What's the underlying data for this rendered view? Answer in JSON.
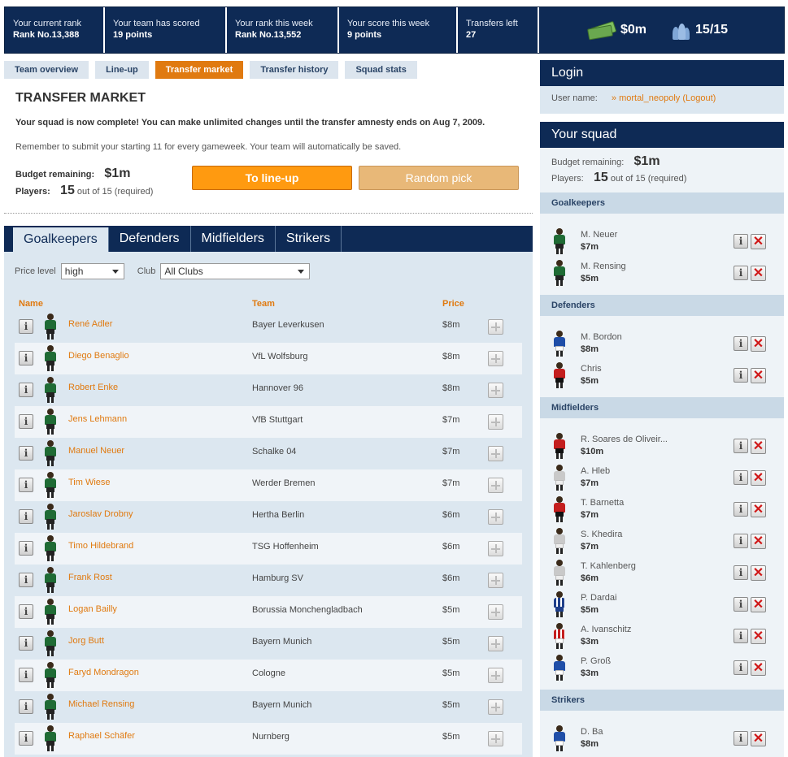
{
  "stats": [
    {
      "label": "Your current rank",
      "value": "Rank No.13,388"
    },
    {
      "label": "Your team has scored",
      "value": "19 points"
    },
    {
      "label": "Your rank this week",
      "value": "Rank No.13,552"
    },
    {
      "label": "Your score this week",
      "value": "9 points"
    },
    {
      "label": "Transfers left",
      "value": "27"
    }
  ],
  "summary": {
    "money": "$0m",
    "players": "15/15"
  },
  "nav_tabs": [
    "Team overview",
    "Line-up",
    "Transfer market",
    "Transfer history",
    "Squad stats"
  ],
  "market": {
    "title": "TRANSFER MARKET",
    "message": "Your squad is now complete! You can make unlimited changes until the transfer amnesty ends on Aug 7, 2009.",
    "reminder": "Remember to submit your starting 11 for every gameweek. Your team will automatically be saved.",
    "budget_label": "Budget remaining:",
    "budget_value": "$1m",
    "players_label": "Players:",
    "players_value": "15",
    "players_suffix": "out of 15 (required)",
    "lineup_button": "To line-up",
    "random_button": "Random pick"
  },
  "position_tabs": [
    "Goalkeepers",
    "Defenders",
    "Midfielders",
    "Strikers"
  ],
  "filters": {
    "price_label": "Price level",
    "price_value": "high",
    "club_label": "Club",
    "club_value": "All Clubs"
  },
  "columns": {
    "name": "Name",
    "team": "Team",
    "price": "Price"
  },
  "players": [
    {
      "name": "René Adler",
      "team": "Bayer Leverkusen",
      "price": "$8m"
    },
    {
      "name": "Diego Benaglio",
      "team": "VfL Wolfsburg",
      "price": "$8m"
    },
    {
      "name": "Robert Enke",
      "team": "Hannover 96",
      "price": "$8m"
    },
    {
      "name": "Jens Lehmann",
      "team": "VfB Stuttgart",
      "price": "$7m"
    },
    {
      "name": "Manuel Neuer",
      "team": "Schalke 04",
      "price": "$7m"
    },
    {
      "name": "Tim Wiese",
      "team": "Werder Bremen",
      "price": "$7m"
    },
    {
      "name": "Jaroslav Drobny",
      "team": "Hertha Berlin",
      "price": "$6m"
    },
    {
      "name": "Timo Hildebrand",
      "team": "TSG Hoffenheim",
      "price": "$6m"
    },
    {
      "name": "Frank Rost",
      "team": "Hamburg SV",
      "price": "$6m"
    },
    {
      "name": "Logan Bailly",
      "team": "Borussia Monchengladbach",
      "price": "$5m"
    },
    {
      "name": "Jorg Butt",
      "team": "Bayern Munich",
      "price": "$5m"
    },
    {
      "name": "Faryd Mondragon",
      "team": "Cologne",
      "price": "$5m"
    },
    {
      "name": "Michael Rensing",
      "team": "Bayern Munich",
      "price": "$5m"
    },
    {
      "name": "Raphael Schäfer",
      "team": "Nurnberg",
      "price": "$5m"
    }
  ],
  "login": {
    "title": "Login",
    "user_label": "User name:",
    "user_value": "» mortal_neopoly (Logout)"
  },
  "squad": {
    "title": "Your squad",
    "budget_label": "Budget remaining:",
    "budget_value": "$1m",
    "players_label": "Players:",
    "players_value": "15",
    "players_suffix": "out of 15 (required)",
    "sections": [
      {
        "title": "Goalkeepers",
        "players": [
          {
            "name": "M. Neuer",
            "price": "$7m",
            "kit": "green"
          },
          {
            "name": "M. Rensing",
            "price": "$5m",
            "kit": "green"
          }
        ]
      },
      {
        "title": "Defenders",
        "players": [
          {
            "name": "M. Bordon",
            "price": "$8m",
            "kit": "blue"
          },
          {
            "name": "Chris",
            "price": "$5m",
            "kit": "red"
          }
        ]
      },
      {
        "title": "Midfielders",
        "players": [
          {
            "name": "R. Soares de Oliveir...",
            "price": "$10m",
            "kit": "red"
          },
          {
            "name": "A. Hleb",
            "price": "$7m",
            "kit": "grey"
          },
          {
            "name": "T. Barnetta",
            "price": "$7m",
            "kit": "red"
          },
          {
            "name": "S. Khedira",
            "price": "$7m",
            "kit": "grey"
          },
          {
            "name": "T. Kahlenberg",
            "price": "$6m",
            "kit": "grey"
          },
          {
            "name": "P. Dardai",
            "price": "$5m",
            "kit": "stripe"
          },
          {
            "name": "A. Ivanschitz",
            "price": "$3m",
            "kit": "redwhite"
          },
          {
            "name": "P. Groß",
            "price": "$3m",
            "kit": "blue"
          }
        ]
      },
      {
        "title": "Strikers",
        "players": [
          {
            "name": "D. Ba",
            "price": "$8m",
            "kit": "blue"
          }
        ]
      }
    ]
  }
}
